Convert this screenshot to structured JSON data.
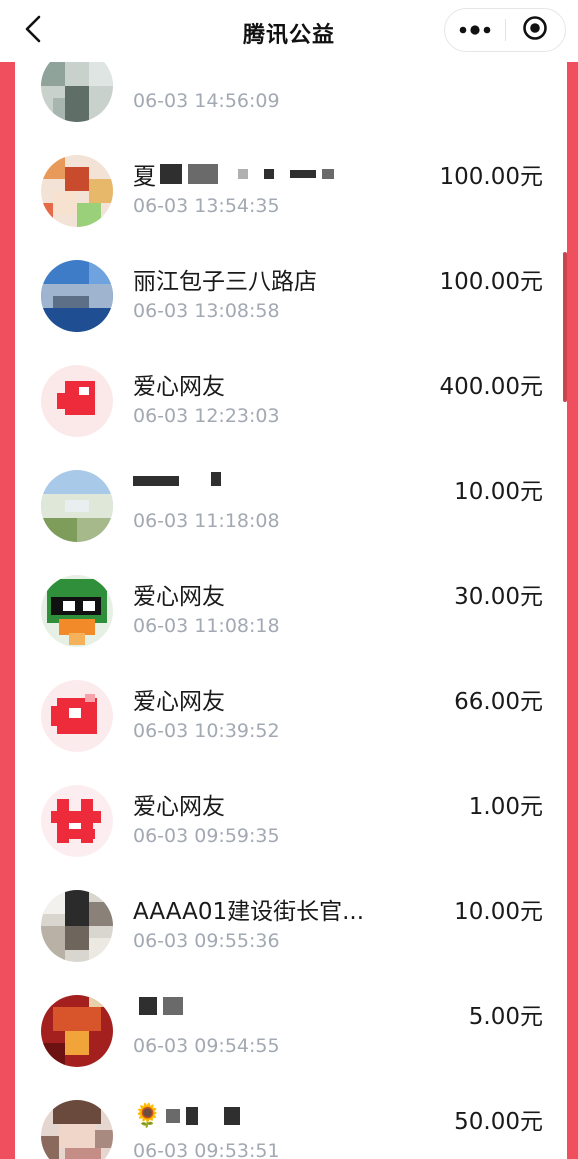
{
  "header": {
    "title": "腾讯公益",
    "back_icon": "chevron-left-icon",
    "more_icon": "more-dots-icon",
    "close_icon": "record-circle-icon"
  },
  "colors": {
    "page_background": "#f0505e",
    "time_text": "#a3a9b3",
    "text": "#1a1a1a"
  },
  "donations": [
    {
      "name": "",
      "time": "06-03 14:56:09",
      "amount": ""
    },
    {
      "name": "夏",
      "time": "06-03 13:54:35",
      "amount": "100.00元"
    },
    {
      "name": "丽江包子三八路店",
      "time": "06-03 13:08:58",
      "amount": "100.00元"
    },
    {
      "name": "爱心网友",
      "time": "06-03 12:23:03",
      "amount": "400.00元"
    },
    {
      "name": "",
      "time": "06-03 11:18:08",
      "amount": "10.00元"
    },
    {
      "name": "爱心网友",
      "time": "06-03 11:08:18",
      "amount": "30.00元"
    },
    {
      "name": "爱心网友",
      "time": "06-03 10:39:52",
      "amount": "66.00元"
    },
    {
      "name": "爱心网友",
      "time": "06-03 09:59:35",
      "amount": "1.00元"
    },
    {
      "name": "AAAA01建设街长官...",
      "time": "06-03 09:55:36",
      "amount": "10.00元"
    },
    {
      "name": "",
      "time": "06-03 09:54:55",
      "amount": "5.00元"
    },
    {
      "name": "🌻",
      "time": "06-03 09:53:51",
      "amount": "50.00元"
    }
  ]
}
